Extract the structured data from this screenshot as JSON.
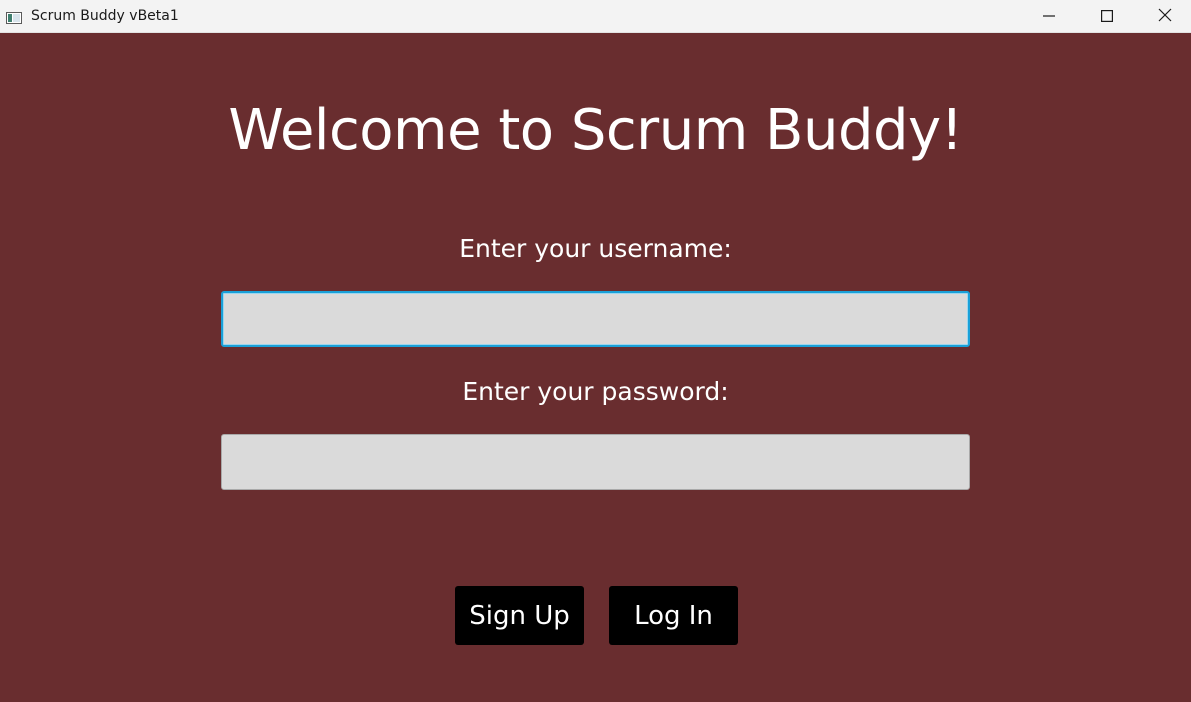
{
  "window": {
    "title": "Scrum Buddy vBeta1",
    "app_icon": "window-app-icon",
    "controls": {
      "minimize_icon": "minimize-icon",
      "maximize_icon": "maximize-icon",
      "close_icon": "close-icon"
    }
  },
  "colors": {
    "background": "#692d2f",
    "titlebar": "#f3f3f3",
    "field": "#dadada",
    "focus_ring": "#1aa0d8",
    "button": "#000000",
    "text": "#ffffff"
  },
  "main": {
    "heading": "Welcome to Scrum Buddy!",
    "username_label": "Enter your username:",
    "username_value": "",
    "password_label": "Enter your password:",
    "password_value": "",
    "signup_label": "Sign Up",
    "login_label": "Log In"
  }
}
